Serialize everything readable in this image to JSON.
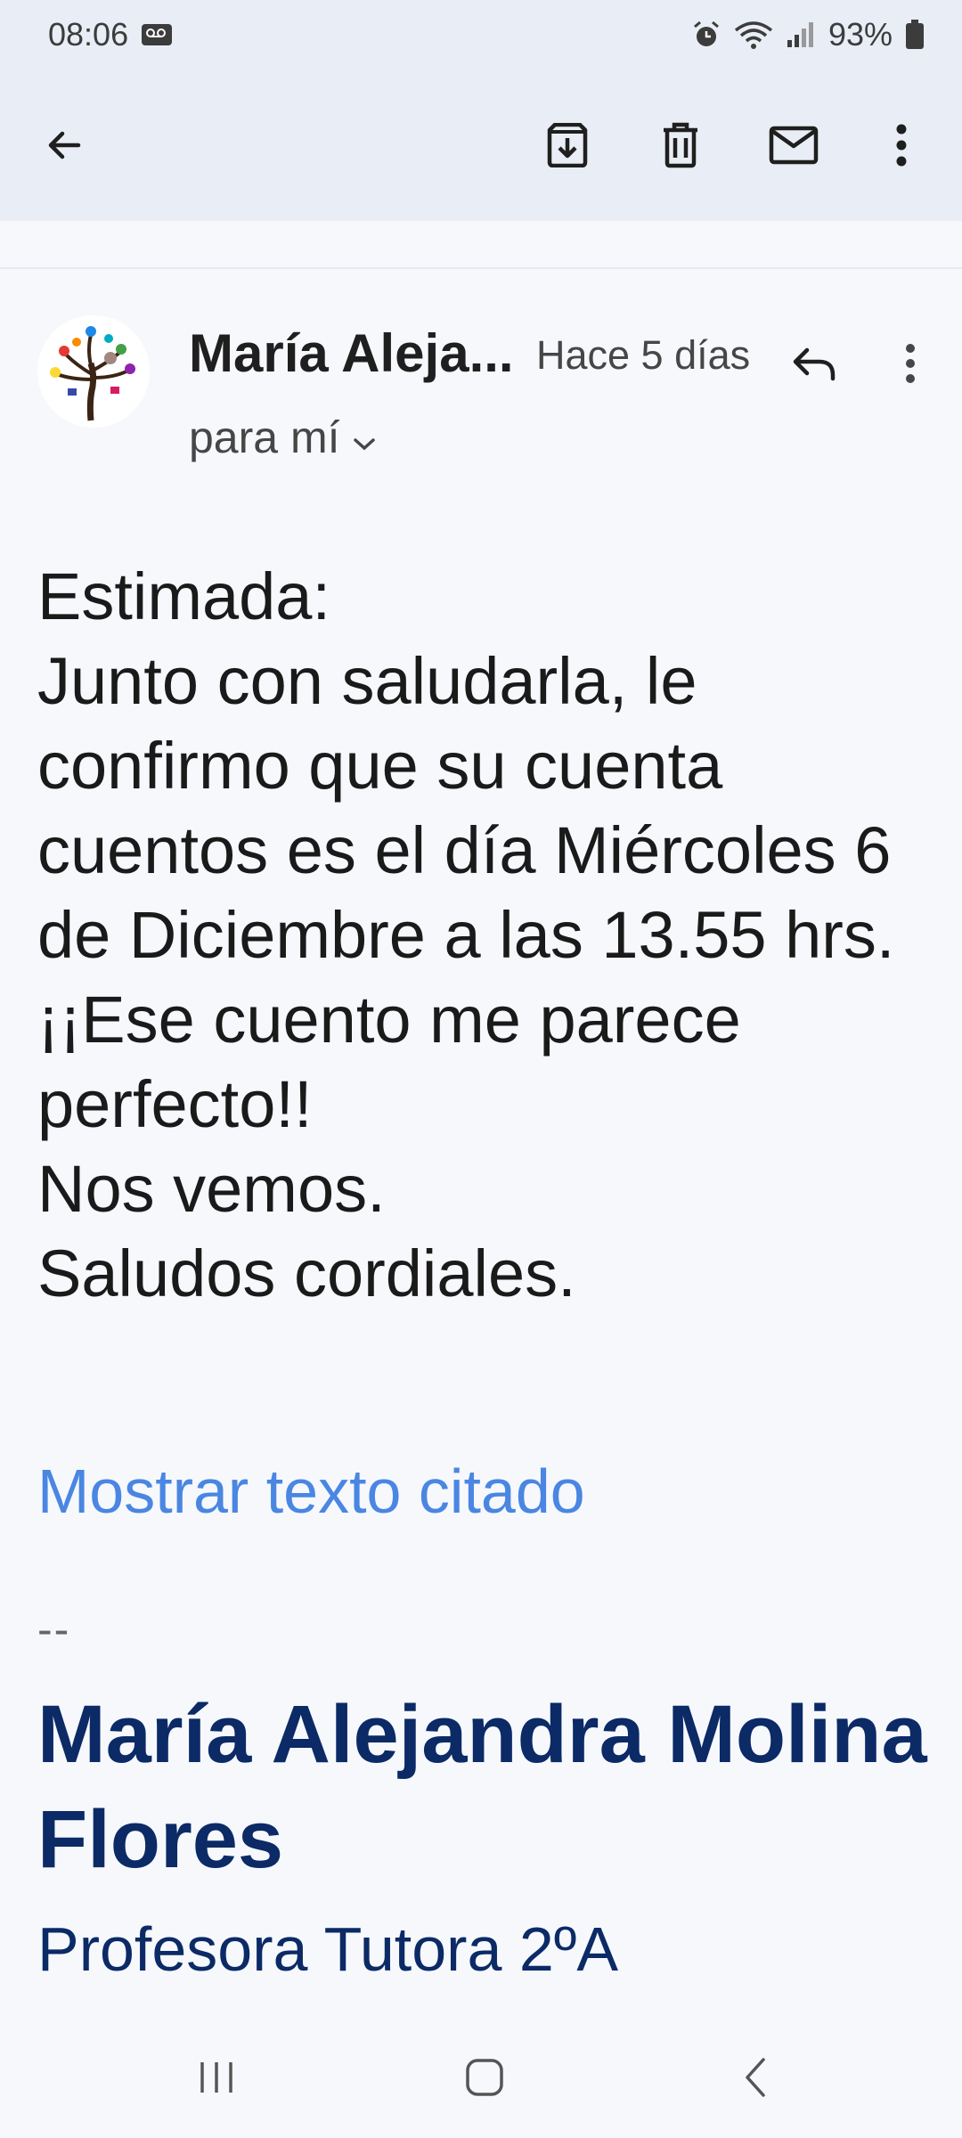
{
  "status_bar": {
    "time": "08:06",
    "battery": "93%"
  },
  "app_bar": {
    "icons": [
      "back-arrow-icon",
      "archive-icon",
      "trash-icon",
      "mail-icon",
      "more-vert-icon"
    ]
  },
  "message": {
    "sender_name": "María Aleja...",
    "time_ago": "Hace 5 días",
    "recipient": "para mí",
    "body_lines": [
      "Estimada:",
      "Junto con saludarla, le confirmo que su cuenta cuentos es el día Miércoles 6 de Diciembre a las 13.55 hrs.",
      "¡¡Ese cuento me parece perfecto!!",
      "Nos vemos.",
      "Saludos cordiales."
    ],
    "show_quoted": "Mostrar texto citado",
    "signature_separator": "--",
    "signature_name": "María Alejandra Molina Flores",
    "signature_title": "Profesora Tutora 2ºA"
  },
  "colors": {
    "header_bg": "#e9eef6",
    "page_bg": "#f6f8fc",
    "link": "#4a86e2",
    "signature": "#0b2a66"
  }
}
